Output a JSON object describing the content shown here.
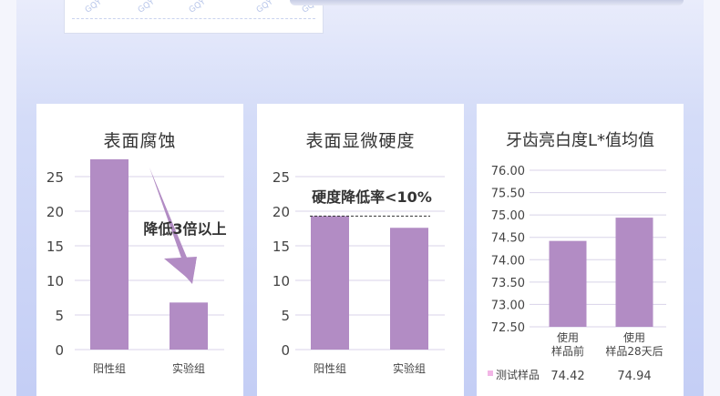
{
  "product_watermark": "GQY",
  "colors": {
    "bar": "#b28cc4",
    "grid": "#d8d3e8",
    "arrow": "#b28cc4",
    "text": "#333333"
  },
  "charts": [
    {
      "title": "表面腐蚀",
      "chart_data": {
        "type": "bar",
        "title": "表面腐蚀",
        "categories": [
          "阳性组",
          "实验组"
        ],
        "values": [
          27.5,
          6.8
        ],
        "ylim": [
          0,
          27.5
        ],
        "yticks": [
          "0",
          "5",
          "10",
          "15",
          "20",
          "25"
        ],
        "grid": true,
        "annotations": [
          "降低3倍以上"
        ]
      }
    },
    {
      "title": "表面显微硬度",
      "chart_data": {
        "type": "bar",
        "title": "表面显微硬度",
        "categories": [
          "阳性组",
          "实验组"
        ],
        "values": [
          19.3,
          17.6
        ],
        "ylim": [
          0,
          27.5
        ],
        "yticks": [
          "0",
          "5",
          "10",
          "15",
          "20",
          "25"
        ],
        "grid": true,
        "annotations": [
          "硬度降低率<10%"
        ]
      }
    },
    {
      "title": "牙齿亮白度L*值均值",
      "chart_data": {
        "type": "bar",
        "title": "牙齿亮白度L*值均值",
        "categories": [
          [
            "使用",
            "样品前"
          ],
          [
            "使用",
            "样品28天后"
          ]
        ],
        "series": [
          {
            "name": "测试样品",
            "values": [
              74.42,
              74.94
            ]
          }
        ],
        "data_labels": [
          "74.42",
          "74.94"
        ],
        "ylim": [
          72.5,
          76.0
        ],
        "yticks": [
          "72.50",
          "73.00",
          "73.50",
          "74.00",
          "74.50",
          "75.00",
          "75.50",
          "76.00"
        ],
        "grid": true
      }
    }
  ]
}
